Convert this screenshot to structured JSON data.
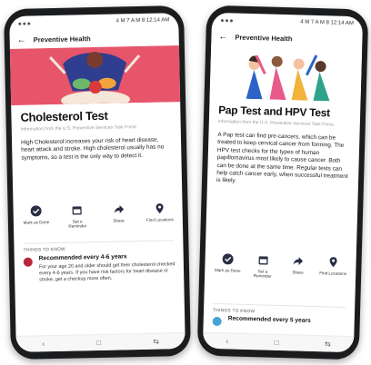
{
  "phone1": {
    "status_time": "4 M 7 A M 8 12:14 AM",
    "app_title": "Preventive Health",
    "title": "Cholesterol Test",
    "subtitle": "Information from the U.S. Preventive Services Task Force",
    "description": "High Cholesterol increases your risk of heart disease, heart attack and stroke. High cholesterol usually has no symptoms, so a test is the only way to detect it.",
    "actions": [
      {
        "label": "Mark as Done",
        "icon": "check-circle-icon"
      },
      {
        "label": "Set a Reminder",
        "icon": "calendar-icon"
      },
      {
        "label": "Share",
        "icon": "share-icon"
      },
      {
        "label": "Find Locations",
        "icon": "location-pin-icon"
      }
    ],
    "section_label": "THINGS TO KNOW",
    "rec_title": "Recommended every 4-6 years",
    "rec_body": "For your age 20 and older should get their cholesterol checked every 4-6 years. If you have risk factors for heart disease or stroke, get a checkup more often.",
    "accent": "#e7556b"
  },
  "phone2": {
    "status_time": "4 M 7 A M 8 12:14 AM",
    "app_title": "Preventive Health",
    "title": "Pap Test and HPV Test",
    "subtitle": "Information from the U.S. Preventive Services Task Force",
    "description": "A Pap test can find pre-cancers, which can be treated to keep cervical cancer from forming. The HPV test checks for the types of human papillomavirus most likely to cause cancer. Both can be done at the same time. Regular tests can help catch cancer early, when successful treatment is likely.",
    "actions": [
      {
        "label": "Mark as Done",
        "icon": "check-circle-icon"
      },
      {
        "label": "Set a Reminder",
        "icon": "calendar-icon"
      },
      {
        "label": "Share",
        "icon": "share-icon"
      },
      {
        "label": "Find Locations",
        "icon": "location-pin-icon"
      }
    ],
    "section_label": "THINGS TO KNOW",
    "rec_title": "Recommended every 5 years",
    "accent": "#4aa3d8"
  },
  "nav": {
    "back": "‹",
    "home": "□",
    "recent": "⇆"
  }
}
